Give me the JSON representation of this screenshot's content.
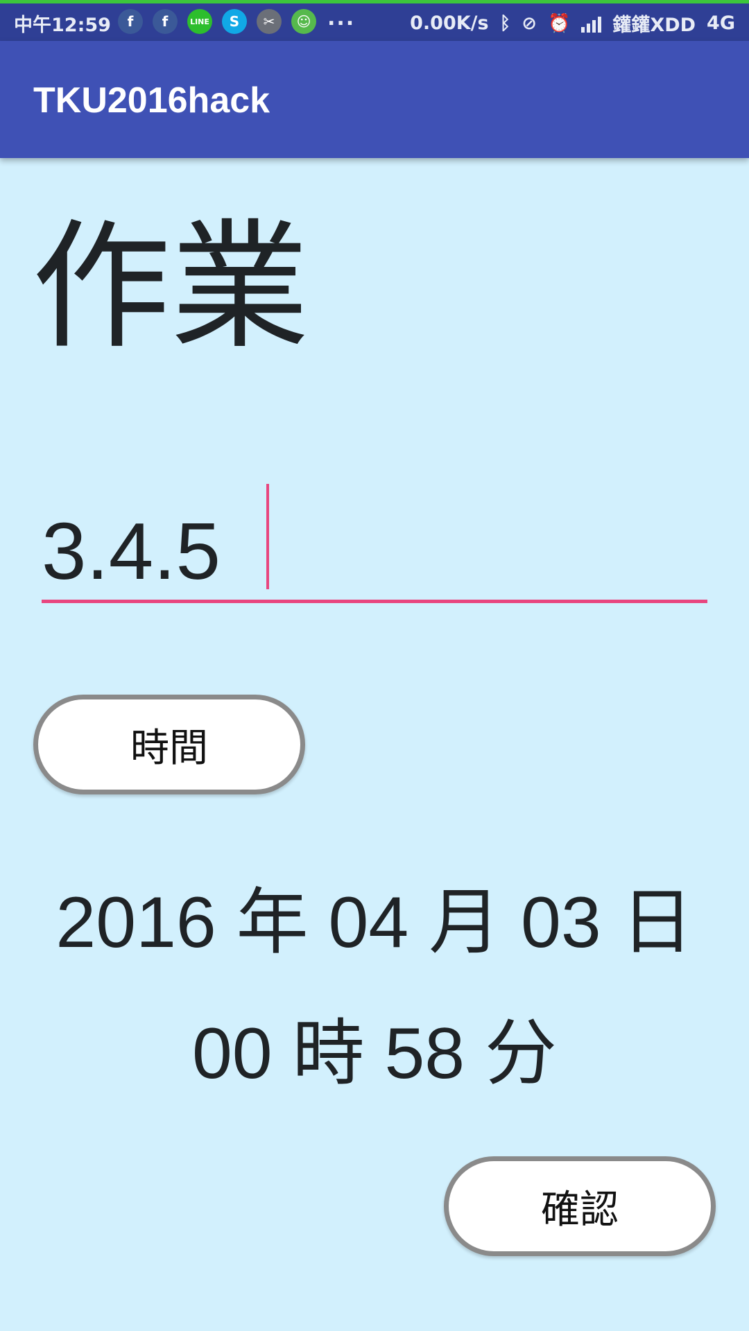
{
  "status_bar": {
    "time": "中午12:59",
    "notification_icons": [
      {
        "name": "facebook-icon",
        "glyph": "f",
        "color": "#3b5998"
      },
      {
        "name": "facebook-icon",
        "glyph": "f",
        "color": "#3b5998"
      },
      {
        "name": "line-icon",
        "glyph": "LINE",
        "color": "#2dbe2d"
      },
      {
        "name": "skype-icon",
        "glyph": "S",
        "color": "#11a8e6"
      },
      {
        "name": "app-icon",
        "glyph": "✂",
        "color": "#6b6f78"
      },
      {
        "name": "frog-app-icon",
        "glyph": "☺",
        "color": "#56b94c"
      }
    ],
    "more": "...",
    "net_speed": "0.00K/s",
    "carrier": "鑵鑵XDD",
    "network": "4G"
  },
  "app_bar": {
    "title": "TKU2016hack"
  },
  "heading": "作業",
  "input": {
    "value": "3.4.5"
  },
  "buttons": {
    "time": "時間",
    "confirm": "確認"
  },
  "datetime": {
    "line1": "2016 年 04 月 03 日",
    "line2": "00 時 58 分"
  },
  "colors": {
    "background": "#d2f0fd",
    "app_bar": "#3f51b5",
    "status_bar": "#2f3f95",
    "accent": "#e8467f"
  }
}
